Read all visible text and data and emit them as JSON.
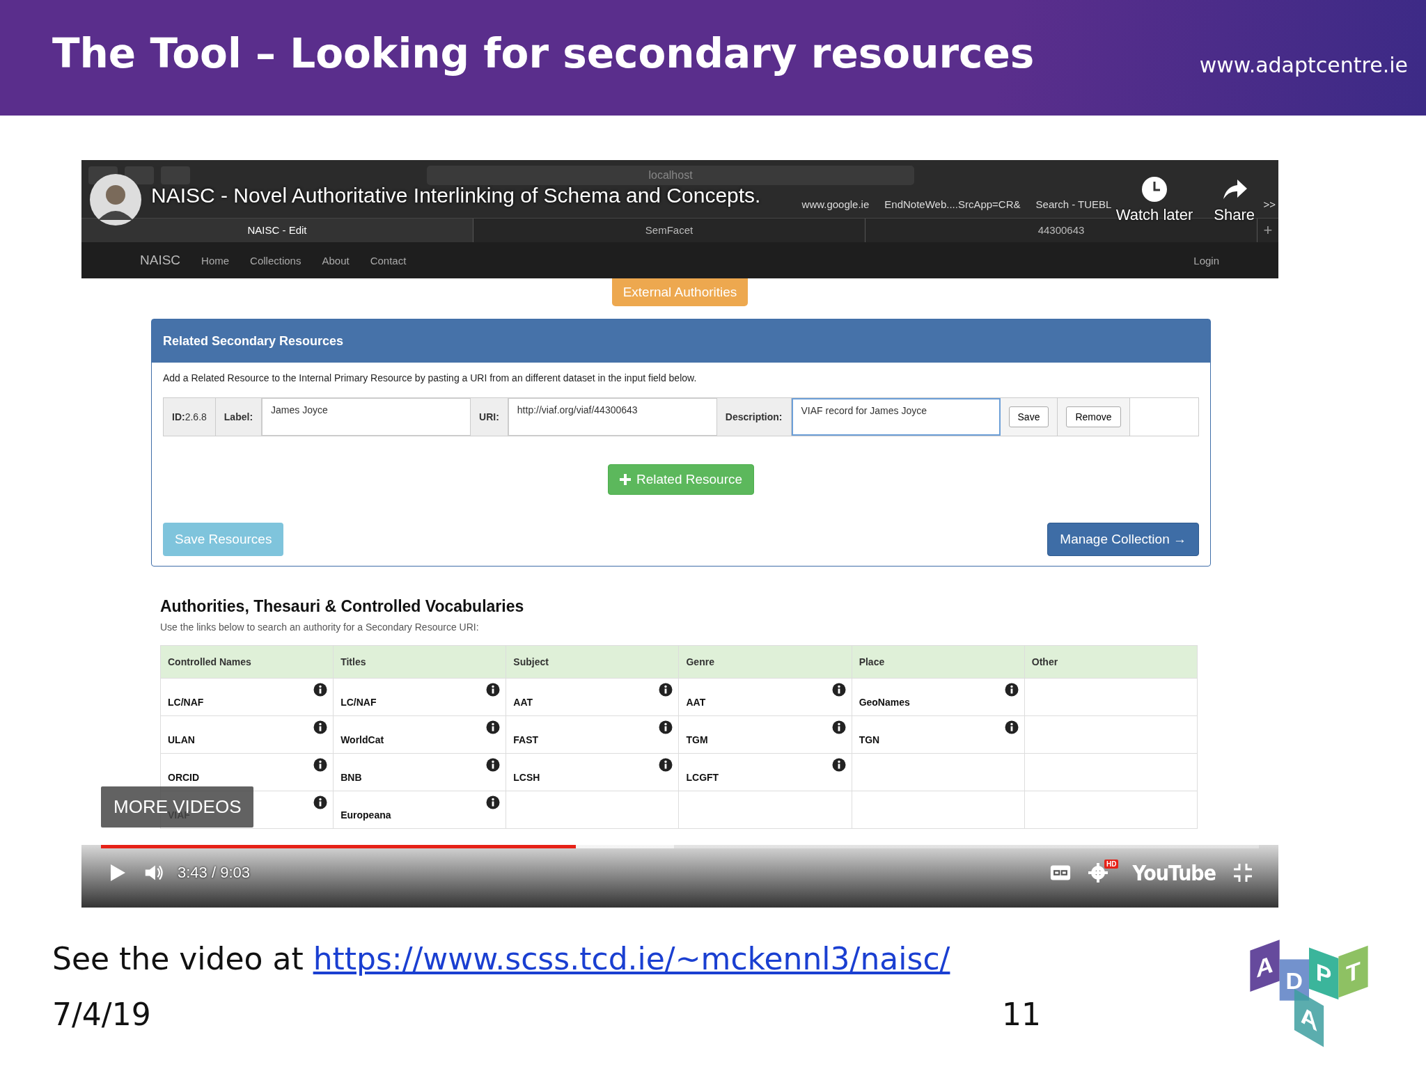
{
  "slide": {
    "title": "The Tool – Looking for secondary resources",
    "website": "www.adaptcentre.ie",
    "footer_text": "See the video at ",
    "footer_link": "https://www.scss.tcd.ie/~mckennl3/naisc/",
    "date": "7/4/19",
    "page_number": "11",
    "logo_letters": [
      "A",
      "D",
      "A",
      "P",
      "T"
    ]
  },
  "video": {
    "title": "NAISC - Novel Authoritative Interlinking of Schema and Concepts.",
    "watch_later": "Watch later",
    "share": "Share",
    "more_videos": "MORE VIDEOS",
    "time": "3:43 / 9:03",
    "hd_badge": "HD",
    "brand": "YouTube",
    "progress": {
      "level": 0.41
    },
    "buffer": {
      "level": 0.495
    }
  },
  "browser": {
    "address": "localhost",
    "bookmarks": [
      "www.google.ie",
      "EndNoteWeb....SrcApp=CR&",
      "Search - TUEBL"
    ],
    "overflow": ">>",
    "tabs": [
      {
        "label": "NAISC - Edit",
        "selected": true
      },
      {
        "label": "SemFacet",
        "selected": false
      },
      {
        "label": "44300643",
        "selected": false
      }
    ],
    "new_tab": "+"
  },
  "navbar": {
    "brand": "NAISC",
    "items": [
      "Home",
      "Collections",
      "About",
      "Contact"
    ],
    "login": "Login"
  },
  "external_button": "External Authorities",
  "panel": {
    "title": "Related Secondary Resources",
    "intro": "Add a Related Resource to the Internal Primary Resource by pasting a URI from an different dataset in the input field below.",
    "id_label": "ID:",
    "id_value": "2.6.8",
    "fields": [
      {
        "label": "Label:",
        "value": "James Joyce",
        "focused": false
      },
      {
        "label": "URI:",
        "value": "http://viaf.org/viaf/44300643",
        "focused": false
      },
      {
        "label": "Description:",
        "value": "VIAF record for James Joyce",
        "focused": true
      }
    ],
    "row_buttons": [
      "Save",
      "Remove"
    ],
    "add_button": "Related Resource",
    "save_button": "Save Resources",
    "manage_button": "Manage Collection →"
  },
  "authorities": {
    "title": "Authorities, Thesauri & Controlled Vocabularies",
    "subtitle": "Use the links below to search an authority for a Secondary Resource URI:",
    "columns": [
      "Controlled Names",
      "Titles",
      "Subject",
      "Genre",
      "Place",
      "Other"
    ],
    "rows": [
      [
        {
          "text": "LC/NAF",
          "info": true
        },
        {
          "text": "LC/NAF",
          "info": true
        },
        {
          "text": "AAT",
          "info": true
        },
        {
          "text": "AAT",
          "info": true
        },
        {
          "text": "GeoNames",
          "info": true
        },
        {
          "info": false
        }
      ],
      [
        {
          "text": "ULAN",
          "info": true
        },
        {
          "text": "WorldCat",
          "info": true
        },
        {
          "text": "FAST",
          "info": true
        },
        {
          "text": "TGM",
          "info": true
        },
        {
          "text": "TGN",
          "info": true
        },
        {
          "info": false
        }
      ],
      [
        {
          "text": "ORCID",
          "info": true
        },
        {
          "text": "BNB",
          "info": true
        },
        {
          "text": "LCSH",
          "info": true
        },
        {
          "text": "LCGFT",
          "info": true
        },
        {
          "info": false
        },
        {
          "info": false
        }
      ],
      [
        {
          "text": "VIAF",
          "info": true
        },
        {
          "text": "Europeana",
          "info": true
        },
        {
          "info": false
        },
        {
          "info": false
        },
        {
          "info": false
        },
        {
          "info": false
        }
      ]
    ]
  }
}
